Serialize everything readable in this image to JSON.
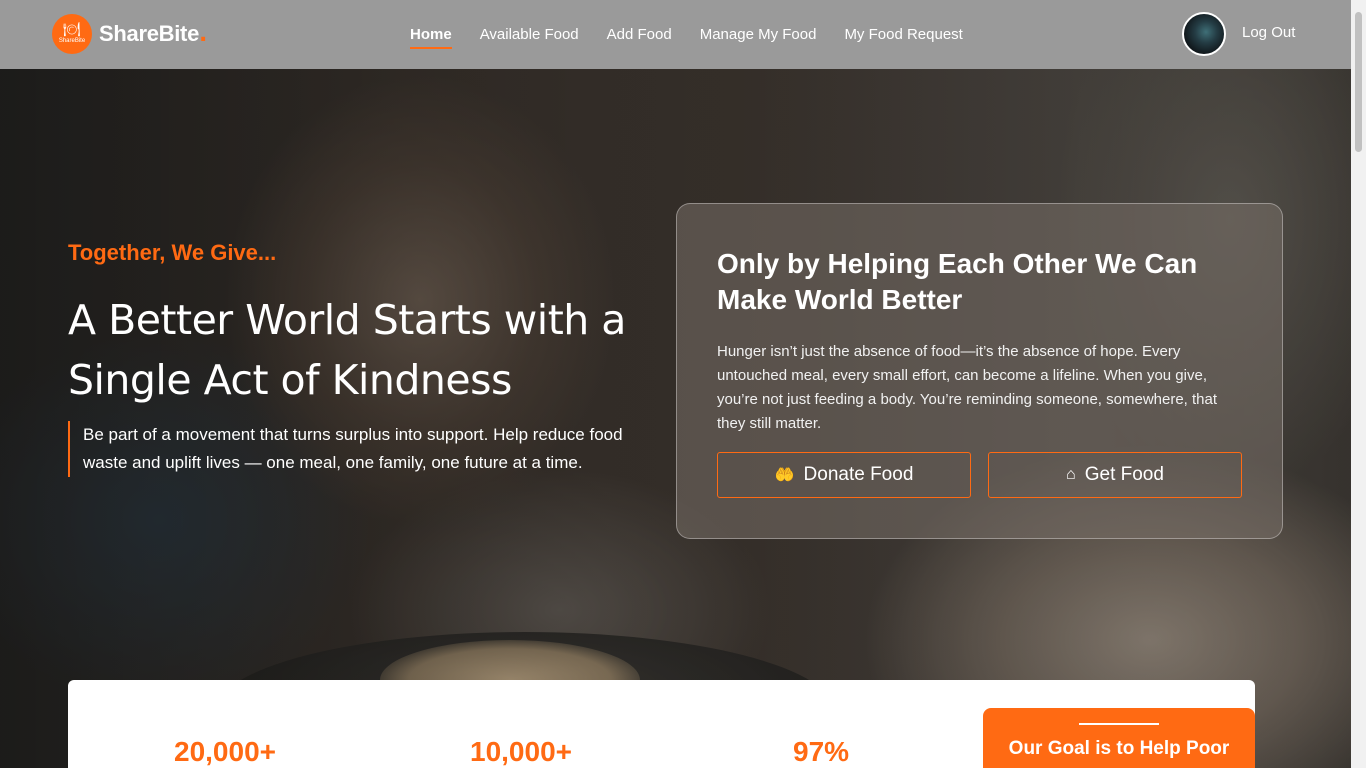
{
  "brand": {
    "name": "ShareBite",
    "badge_text": "ShareBite"
  },
  "nav": {
    "items": [
      {
        "label": "Home",
        "active": true
      },
      {
        "label": "Available Food",
        "active": false
      },
      {
        "label": "Add Food",
        "active": false
      },
      {
        "label": "Manage My Food",
        "active": false
      },
      {
        "label": "My Food Request",
        "active": false
      }
    ],
    "logout": "Log Out"
  },
  "hero": {
    "tagline": "Together, We Give...",
    "headline": "A Better World Starts with a Single Act of Kindness",
    "intro": "Be part of a movement that turns surplus into support. Help reduce food waste and uplift lives — one meal, one family, one future at a time."
  },
  "card": {
    "title": "Only by Helping Each Other We Can Make World Better",
    "body": "Hunger isn’t just the absence of food—it’s the absence of hope. Every untouched meal, every small effort, can become a lifeline. When you give, you’re not just feeding a body. You’re reminding someone, somewhere, that they still matter.",
    "donate_label": "Donate Food",
    "get_label": "Get Food"
  },
  "stats": {
    "values": [
      "20,000+",
      "10,000+",
      "97%"
    ]
  },
  "goal": {
    "title": "Our Goal is to Help Poor"
  },
  "colors": {
    "accent": "#ff6a13",
    "navbar": "#9a9a9a"
  },
  "icons": {
    "donate": "hand-heart-icon",
    "get": "house-icon"
  }
}
